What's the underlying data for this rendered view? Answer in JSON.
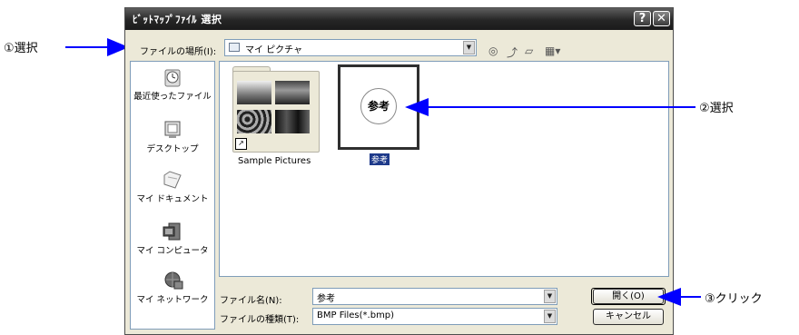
{
  "window": {
    "title": "ﾋﾞｯﾄﾏｯﾌﾟﾌｧｲﾙ 選択",
    "help_label": "?",
    "close_label": "✕"
  },
  "toolbar": {
    "lookin_label": "ファイルの場所(I):",
    "lookin_value": "マイ ピクチャ",
    "icons": [
      "back-icon",
      "up-folder-icon",
      "new-folder-icon",
      "view-menu-icon"
    ]
  },
  "places": [
    {
      "label": "最近使ったファイル",
      "icon": "recent-icon"
    },
    {
      "label": "デスクトップ",
      "icon": "desktop-icon"
    },
    {
      "label": "マイ ドキュメント",
      "icon": "documents-icon"
    },
    {
      "label": "マイ コンピュータ",
      "icon": "computer-icon"
    },
    {
      "label": "マイ ネットワーク",
      "icon": "network-icon"
    }
  ],
  "files": [
    {
      "name": "Sample Pictures",
      "type": "folder"
    },
    {
      "name": "参考",
      "type": "image",
      "thumb_text": "参考",
      "selected": true
    }
  ],
  "filename": {
    "label": "ファイル名(N):",
    "value": "参考"
  },
  "filetype": {
    "label": "ファイルの種類(T):",
    "value": "BMP Files(*.bmp)"
  },
  "buttons": {
    "open": "開く(O)",
    "cancel": "キャンセル"
  },
  "annotations": {
    "callout1": "①選択",
    "callout2": "②選択",
    "callout3": "③クリック",
    "arrow_color": "#0000ff"
  }
}
